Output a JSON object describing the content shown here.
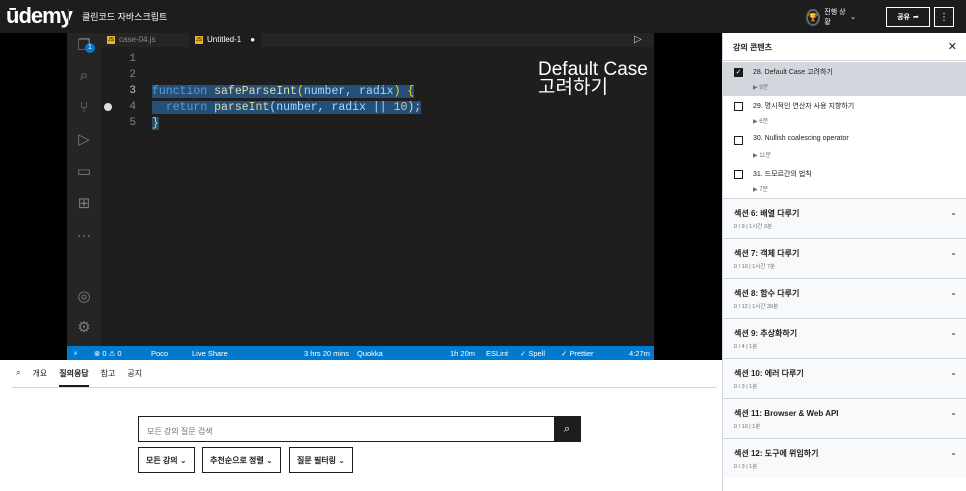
{
  "header": {
    "logo": "ūdemy",
    "course_title": "클린코드 자바스크립트",
    "progress_label": "진행 상황",
    "share_label": "공유",
    "more_label": "⋮"
  },
  "editor": {
    "tabs": [
      {
        "label": "case-04.js"
      },
      {
        "label": "Untitled-1"
      }
    ],
    "explorer_badge": "1",
    "line_numbers": [
      "1",
      "2",
      "3",
      "4",
      "5"
    ],
    "code": {
      "l3_kw": "function",
      "l3_fn": " safeParseInt",
      "l3_open": "(",
      "l3_params": "number, radix",
      "l3_close": ") {",
      "l4_kw": "return",
      "l4_fn": " parseInt",
      "l4_args": "(number, radix || ",
      "l4_num": "10",
      "l4_end": ");",
      "l5": "}"
    },
    "overlay_line1": "Default Case",
    "overlay_line2": "고려하기",
    "statusbar": {
      "errors": "⊗ 0 ⚠ 0",
      "poco": "Poco",
      "live_share": "Live Share",
      "time_tracked": "3 hrs 20 mins",
      "quokka": "Quokka",
      "session": "1h 20m",
      "eslint": "ESLint",
      "spell": "✓ Spell",
      "prettier": "✓ Prettier",
      "timestamp": "4:27m"
    }
  },
  "qa": {
    "tabs": [
      "개요",
      "질의응답",
      "참고",
      "공지"
    ],
    "active_tab": "질의응답",
    "search_placeholder": "모든 강의 질문 검색",
    "filters": [
      "모든 강의 ⌄",
      "추천순으로 정렬 ⌄",
      "질문 필터링 ⌄"
    ]
  },
  "sidebar": {
    "title": "강의 콘텐츠",
    "close": "✕",
    "lectures": [
      {
        "title": "28. Default Case 고려하기",
        "duration": "9분",
        "checked": true
      },
      {
        "title": "29. 명시적인 연산자 사용 지향하기",
        "duration": "6분",
        "checked": false
      },
      {
        "title": "30. Nullish coalescing operator",
        "duration": "11분",
        "checked": false
      },
      {
        "title": "31. 드모르간의 법칙",
        "duration": "7분",
        "checked": false
      }
    ],
    "sections": [
      {
        "title": "섹션 6: 배열 다루기",
        "meta": "0 / 9 | 1시간 3분"
      },
      {
        "title": "섹션 7: 객체 다루기",
        "meta": "0 / 10 | 1시간 7분"
      },
      {
        "title": "섹션 8: 함수 다루기",
        "meta": "0 / 12 | 1시간 39분"
      },
      {
        "title": "섹션 9: 추상화하기",
        "meta": "0 / 4 | 1분"
      },
      {
        "title": "섹션 10: 에러 다루기",
        "meta": "0 / 3 | 1분"
      },
      {
        "title": "섹션 11: Browser & Web API",
        "meta": "0 / 10 | 1분"
      },
      {
        "title": "섹션 12: 도구에 위임하기",
        "meta": "0 / 3 | 1분"
      }
    ]
  },
  "colors": {
    "brand": "#a435f0",
    "statusbar": "#007acc",
    "editor_bg": "#1e1e1e"
  }
}
